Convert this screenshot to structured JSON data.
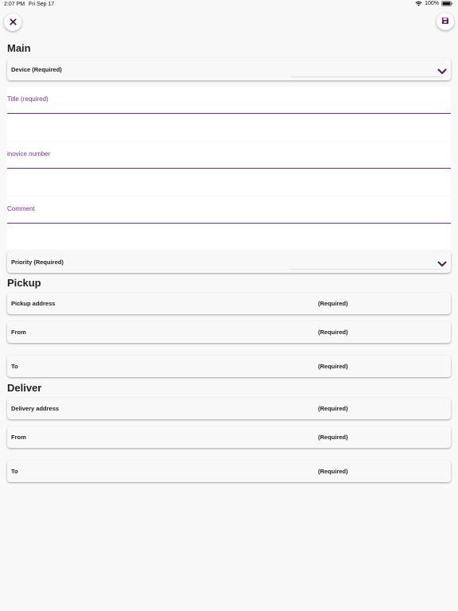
{
  "status_bar": {
    "time": "2:07 PM",
    "date": "Fri Sep 17",
    "battery": "100%"
  },
  "toolbar": {
    "close_icon": "close-icon",
    "save_icon": "floppy-disk-icon"
  },
  "colors": {
    "accent": "#7b2d8e",
    "background": "#f8f8f8"
  },
  "main": {
    "title": "Main",
    "device_label": "Device (Required)",
    "title_field_label": "Title (required)",
    "title_field_value": "",
    "invoice_field_label": "inovice number",
    "invoice_field_value": "",
    "comment_field_label": "Comment",
    "comment_field_value": "",
    "priority_label": "Priority (Required)"
  },
  "pickup": {
    "title": "Pickup",
    "rows": [
      {
        "label": "Pickup address",
        "required": "(Required)"
      },
      {
        "label": "From",
        "required": "(Required)"
      },
      {
        "label": "To",
        "required": "(Required)"
      }
    ]
  },
  "deliver": {
    "title": "Deliver",
    "rows": [
      {
        "label": "Delivery address",
        "required": "(Required)"
      },
      {
        "label": "From",
        "required": "(Required)"
      },
      {
        "label": "To",
        "required": "(Required)"
      }
    ]
  }
}
